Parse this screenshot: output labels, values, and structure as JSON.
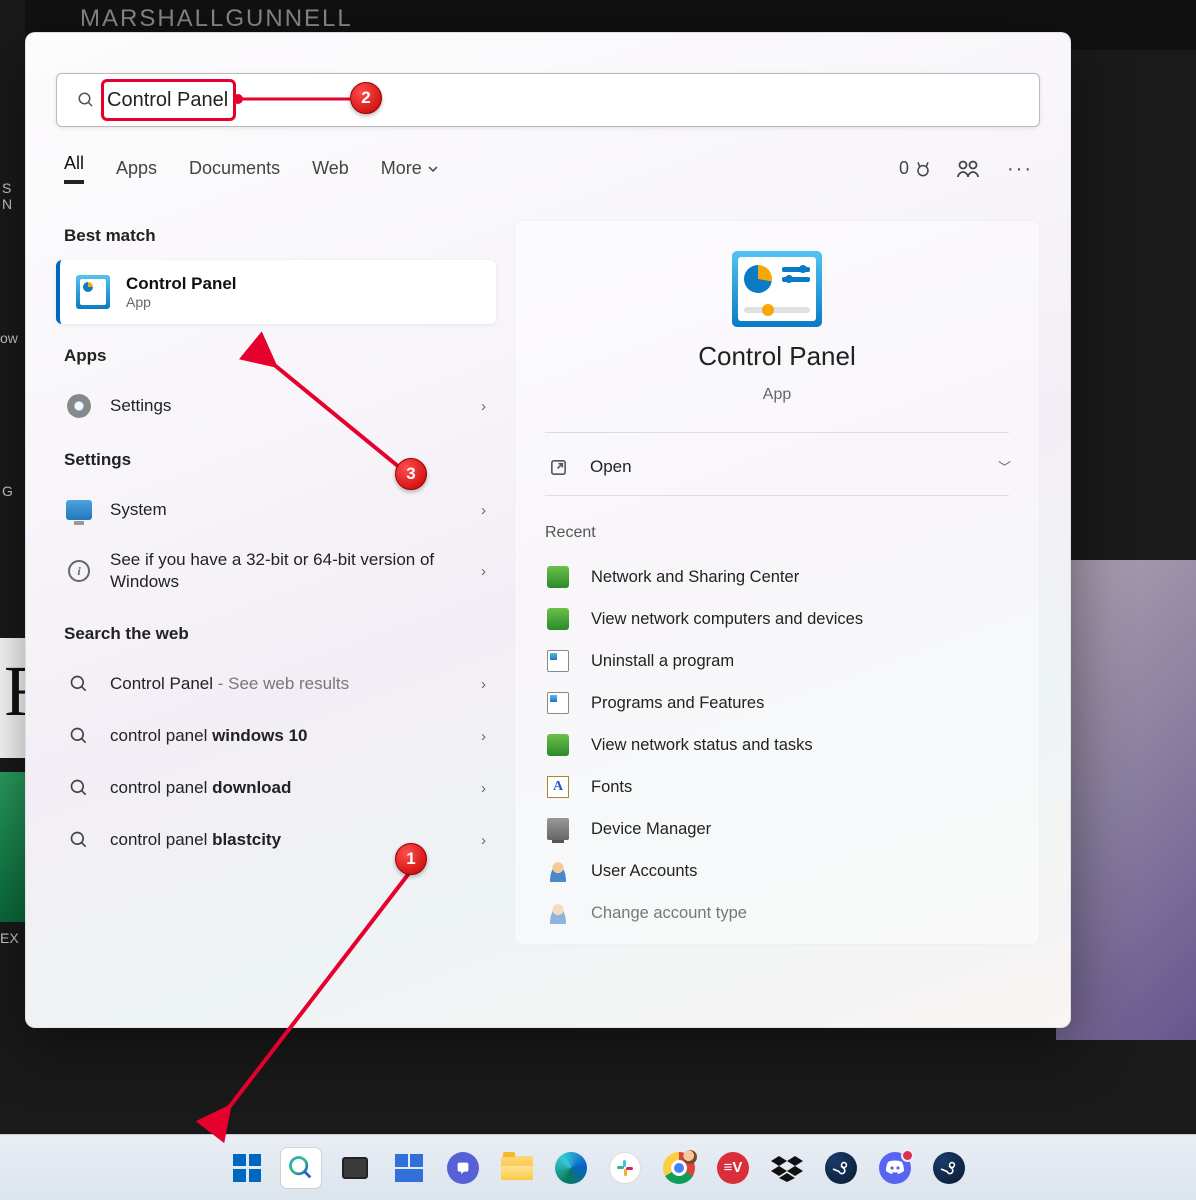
{
  "bg": {
    "title_fragment": "MARSHALLGUNNELL",
    "left_fragments": [
      "S N",
      "ow",
      "G",
      "EX"
    ],
    "left_ff": "FF"
  },
  "search": {
    "value": "Control Panel"
  },
  "filters": {
    "tabs": [
      "All",
      "Apps",
      "Documents",
      "Web",
      "More"
    ],
    "rewards": "0"
  },
  "left_col": {
    "best_label": "Best match",
    "best": {
      "title": "Control Panel",
      "sub": "App"
    },
    "apps_label": "Apps",
    "apps": [
      {
        "label": "Settings"
      }
    ],
    "settings_label": "Settings",
    "settings": [
      {
        "label": "System"
      },
      {
        "label": "See if you have a 32-bit or 64-bit version of Windows"
      }
    ],
    "web_label": "Search the web",
    "web": [
      {
        "prefix": "Control Panel",
        "suffix": " - See web results"
      },
      {
        "pre": "control panel ",
        "bold": "windows 10"
      },
      {
        "pre": "control panel ",
        "bold": "download"
      },
      {
        "pre": "control panel ",
        "bold": "blastcity"
      }
    ]
  },
  "right_col": {
    "title": "Control Panel",
    "sub": "App",
    "open": "Open",
    "recent_label": "Recent",
    "recent": [
      "Network and Sharing Center",
      "View network computers and devices",
      "Uninstall a program",
      "Programs and Features",
      "View network status and tasks",
      "Fonts",
      "Device Manager",
      "User Accounts",
      "Change account type"
    ]
  },
  "anno": {
    "b1": "1",
    "b2": "2",
    "b3": "3"
  }
}
